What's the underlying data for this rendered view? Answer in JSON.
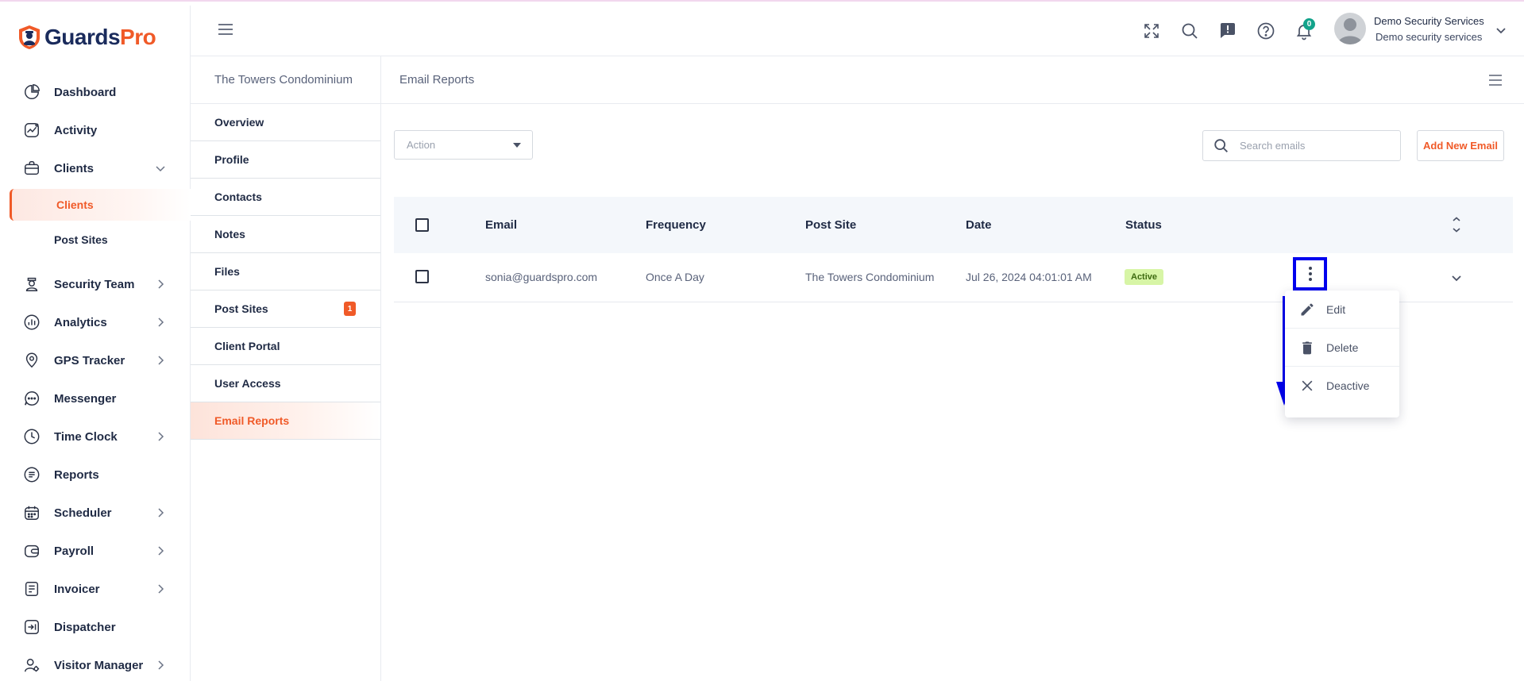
{
  "brand": {
    "name_part1": "Guards",
    "name_part2": "Pro",
    "accent": "#f05a28",
    "navy": "#1a2b5c"
  },
  "sidebar": {
    "items": [
      {
        "label": "Dashboard",
        "icon": "dashboard-icon"
      },
      {
        "label": "Activity",
        "icon": "activity-icon"
      },
      {
        "label": "Clients",
        "icon": "briefcase-icon",
        "expanded": true
      },
      {
        "label": "Security Team",
        "icon": "guard-icon"
      },
      {
        "label": "Analytics",
        "icon": "analytics-icon"
      },
      {
        "label": "GPS Tracker",
        "icon": "location-pin-icon"
      },
      {
        "label": "Messenger",
        "icon": "chat-icon"
      },
      {
        "label": "Time Clock",
        "icon": "clock-icon"
      },
      {
        "label": "Reports",
        "icon": "reports-icon"
      },
      {
        "label": "Scheduler",
        "icon": "calendar-icon"
      },
      {
        "label": "Payroll",
        "icon": "wallet-icon"
      },
      {
        "label": "Invoicer",
        "icon": "invoice-icon"
      },
      {
        "label": "Dispatcher",
        "icon": "dispatch-icon"
      },
      {
        "label": "Visitor Manager",
        "icon": "visitor-icon"
      }
    ],
    "clients_sub": [
      {
        "label": "Clients",
        "active": true
      },
      {
        "label": "Post Sites",
        "active": false
      }
    ]
  },
  "header": {
    "notification_count": "0",
    "user_name": "Demo Security Services",
    "user_company": "Demo security services"
  },
  "client_nav": {
    "title": "The Towers Condominium",
    "items": [
      {
        "label": "Overview"
      },
      {
        "label": "Profile"
      },
      {
        "label": "Contacts"
      },
      {
        "label": "Notes"
      },
      {
        "label": "Files"
      },
      {
        "label": "Post Sites",
        "badge": "1"
      },
      {
        "label": "Client Portal"
      },
      {
        "label": "User Access"
      },
      {
        "label": "Email Reports",
        "active": true
      }
    ]
  },
  "content": {
    "title": "Email Reports",
    "action_placeholder": "Action",
    "search_placeholder": "Search emails",
    "add_button": "Add New Email",
    "table": {
      "headers": {
        "email": "Email",
        "frequency": "Frequency",
        "post_site": "Post Site",
        "date": "Date",
        "status": "Status"
      },
      "rows": [
        {
          "email": "sonia@guardspro.com",
          "frequency": "Once A Day",
          "post_site": "The Towers Condominium",
          "date": "Jul 26, 2024 04:01:01 AM",
          "status": "Active"
        }
      ]
    },
    "row_menu": {
      "edit": "Edit",
      "delete": "Delete",
      "deactive": "Deactive"
    }
  }
}
